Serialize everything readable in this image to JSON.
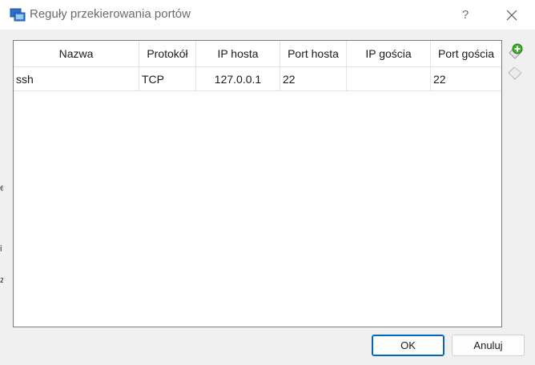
{
  "window": {
    "title": "Reguły przekierowania portów",
    "help_glyph": "?",
    "close_glyph": "✕"
  },
  "parent_strip": {
    "marks": [
      "e",
      "i",
      "z"
    ]
  },
  "table": {
    "columns": [
      "Nazwa",
      "Protokół",
      "IP hosta",
      "Port hosta",
      "IP gościa",
      "Port gościa"
    ],
    "rows": [
      {
        "name": "ssh",
        "protocol": "TCP",
        "host_ip": "127.0.0.1",
        "host_port": "22",
        "guest_ip": "",
        "guest_port": "22"
      }
    ]
  },
  "side_actions": {
    "add_icon": "add-rule-icon",
    "remove_icon": "remove-rule-icon"
  },
  "buttons": {
    "ok": "OK",
    "cancel": "Anuluj"
  },
  "colors": {
    "accent": "#0067c0",
    "add_green": "#3fae2a",
    "icon_blue": "#2f6fc7"
  }
}
